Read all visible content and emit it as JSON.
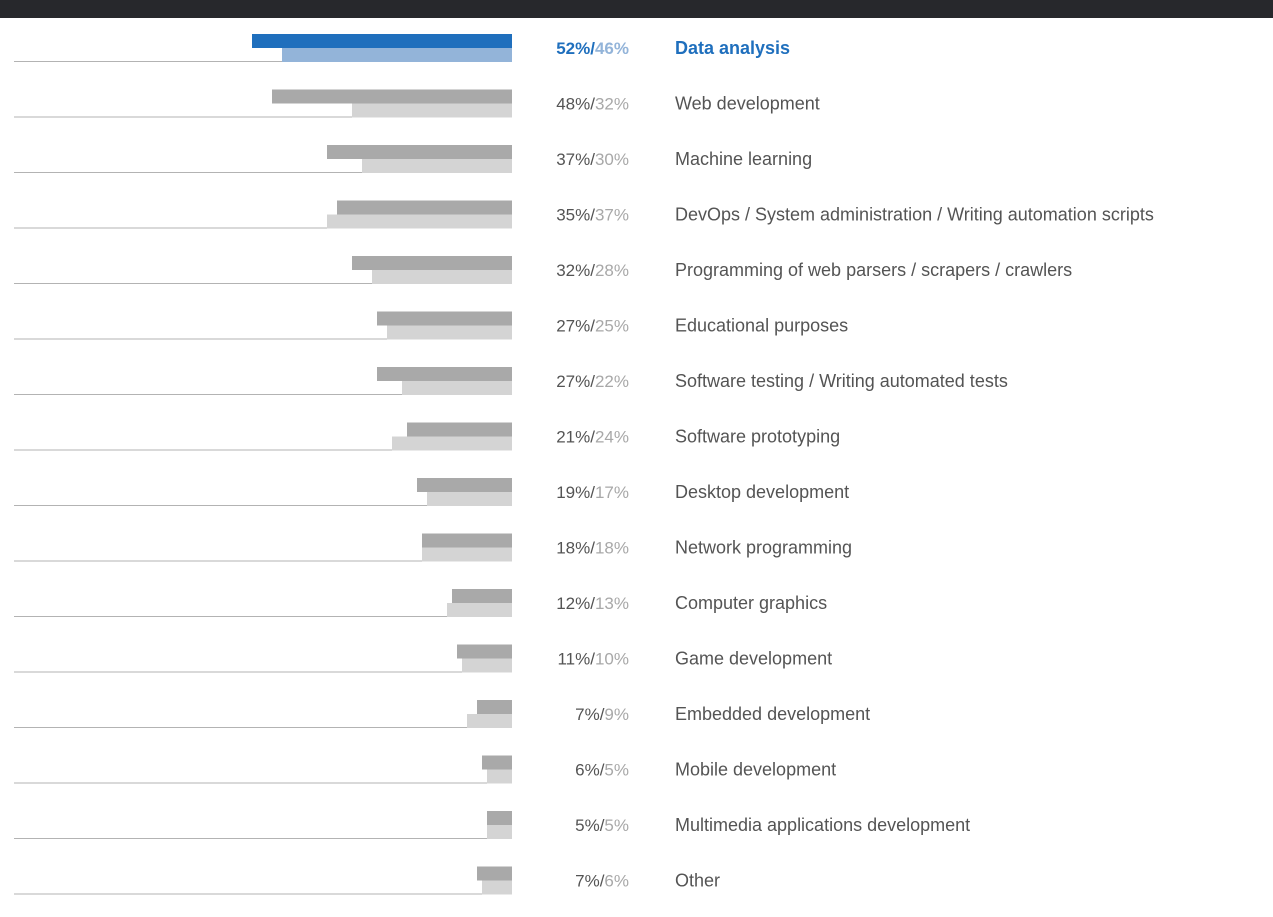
{
  "chart_data": {
    "type": "bar",
    "orientation": "horizontal",
    "categories": [
      "Data analysis",
      "Web development",
      "Machine learning",
      "DevOps / System administration / Writing automation scripts",
      "Programming of web parsers / scrapers / crawlers",
      "Educational purposes",
      "Software testing / Writing automated tests",
      "Software prototyping",
      "Desktop development",
      "Network programming",
      "Computer graphics",
      "Game development",
      "Embedded development",
      "Mobile development",
      "Multimedia applications development",
      "Other"
    ],
    "series": [
      {
        "values": [
          52,
          48,
          37,
          35,
          32,
          27,
          27,
          21,
          19,
          18,
          12,
          11,
          7,
          6,
          5,
          7
        ]
      },
      {
        "values": [
          46,
          32,
          30,
          37,
          28,
          25,
          22,
          24,
          17,
          18,
          13,
          10,
          9,
          5,
          5,
          6
        ]
      }
    ],
    "value_suffix": "%",
    "separator": "/",
    "highlight_index": 0,
    "xlim": [
      0,
      100
    ],
    "colors": {
      "highlight_primary": "#1f6fbd",
      "highlight_secondary": "#93b4d9",
      "primary": "#a9a9a9",
      "secondary": "#d4d4d4",
      "baseline": "#b3b3b3",
      "label": "#545454",
      "secondary_label": "#a8a8a8",
      "top_bar": "#27282c"
    }
  }
}
